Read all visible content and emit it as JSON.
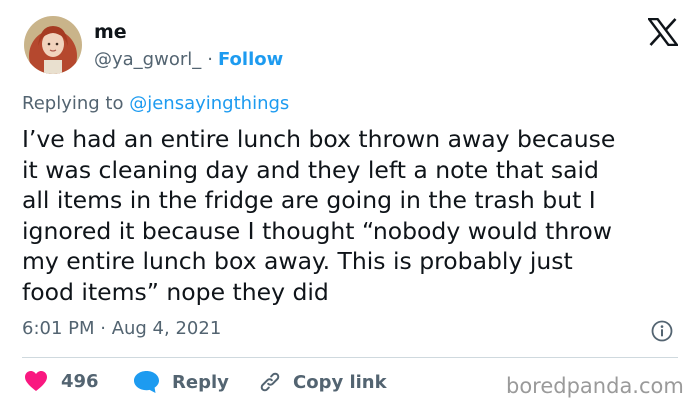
{
  "author": {
    "name": "me",
    "handle": "@ya_gworl_",
    "separator": "·",
    "follow_label": "Follow",
    "avatar_icon": "avatar-portrait-icon"
  },
  "platform_icon": "x-logo-icon",
  "reply_context": {
    "prefix": "Replying to",
    "mention": "@jensayingthings"
  },
  "tweet": {
    "text": "I’ve had an entire lunch box thrown away because\nit was cleaning day and they left a note that said\nall items in the fridge are going in the trash but I\nignored it because I thought “nobody would throw\nmy entire lunch box away. This is probably just\nfood items” nope they did",
    "timestamp": "6:01 PM · Aug 4, 2021"
  },
  "actions": {
    "like_count": "496",
    "reply_label": "Reply",
    "copy_link_label": "Copy link"
  },
  "watermark": "boredpanda.com",
  "colors": {
    "accent": "#1d9bf0",
    "like": "#f91880",
    "muted": "#536471",
    "text": "#0f1419"
  }
}
